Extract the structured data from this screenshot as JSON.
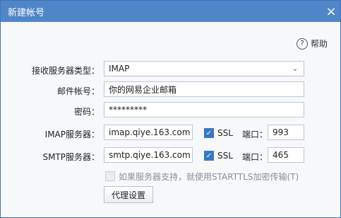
{
  "window": {
    "title": "新建帐号",
    "close_icon": "×"
  },
  "help": {
    "icon": "?",
    "label": "帮助"
  },
  "form": {
    "receive_type_label": "接收服务器类型：",
    "receive_type_value": "IMAP",
    "email_label": "邮件帐号：",
    "email_value": "你的网易企业邮箱",
    "password_label": "密码：",
    "password_value": "*********",
    "imap_label": "IMAP服务器：",
    "imap_value": "imap.qiye.163.com",
    "smtp_label": "SMTP服务器：",
    "smtp_value": "smtp.qiye.163.com",
    "ssl_label": "SSL",
    "port_label": "端口：",
    "imap_port": "993",
    "smtp_port": "465",
    "starttls_label": "如果服务器支持，就使用STARTTLS加密传输(T)",
    "proxy_button": "代理设置"
  }
}
